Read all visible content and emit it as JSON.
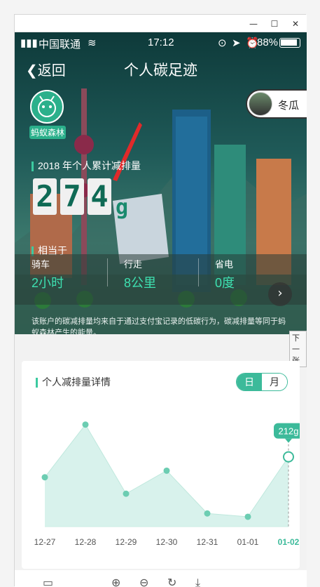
{
  "window": {
    "min_icon": "minimize-icon",
    "max_icon": "maximize-icon",
    "close_icon": "close-icon"
  },
  "status": {
    "carrier": "中国联通",
    "time": "17:12",
    "battery": "88%"
  },
  "nav": {
    "back_label": "返回",
    "title": "个人碳足迹"
  },
  "logo": {
    "text": "蚂蚁森林"
  },
  "user": {
    "name": "冬瓜"
  },
  "summary": {
    "label": "2018 年个人累计减排量",
    "digits": [
      "2",
      "7",
      "4"
    ],
    "unit": "g"
  },
  "equivalent": {
    "label": "相当于"
  },
  "stats": [
    {
      "label": "骑车",
      "value": "2小时"
    },
    {
      "label": "行走",
      "value": "8公里"
    },
    {
      "label": "省电",
      "value": "0度"
    }
  ],
  "note": "该账户的碳减排量均来自于通过支付宝记录的低碳行为，碳减排量等同于蚂蚁森林产生的能量。",
  "tooltip": "下一张",
  "card": {
    "title": "个人减排量详情",
    "tab_day": "日",
    "tab_month": "月"
  },
  "chart_data": {
    "type": "area",
    "categories": [
      "12-27",
      "12-28",
      "12-29",
      "12-30",
      "12-31",
      "01-01",
      "01-02"
    ],
    "values": [
      150,
      310,
      100,
      170,
      40,
      30,
      212
    ],
    "highlight_index": 6,
    "highlight_label": "212g",
    "ylim": [
      0,
      400
    ],
    "color": "#3cba9a",
    "fill": "#d8f2ec"
  },
  "toolbar": {
    "icons": [
      "screen-icon",
      "zoom-in-icon",
      "zoom-out-icon",
      "rotate-icon",
      "download-icon"
    ]
  }
}
